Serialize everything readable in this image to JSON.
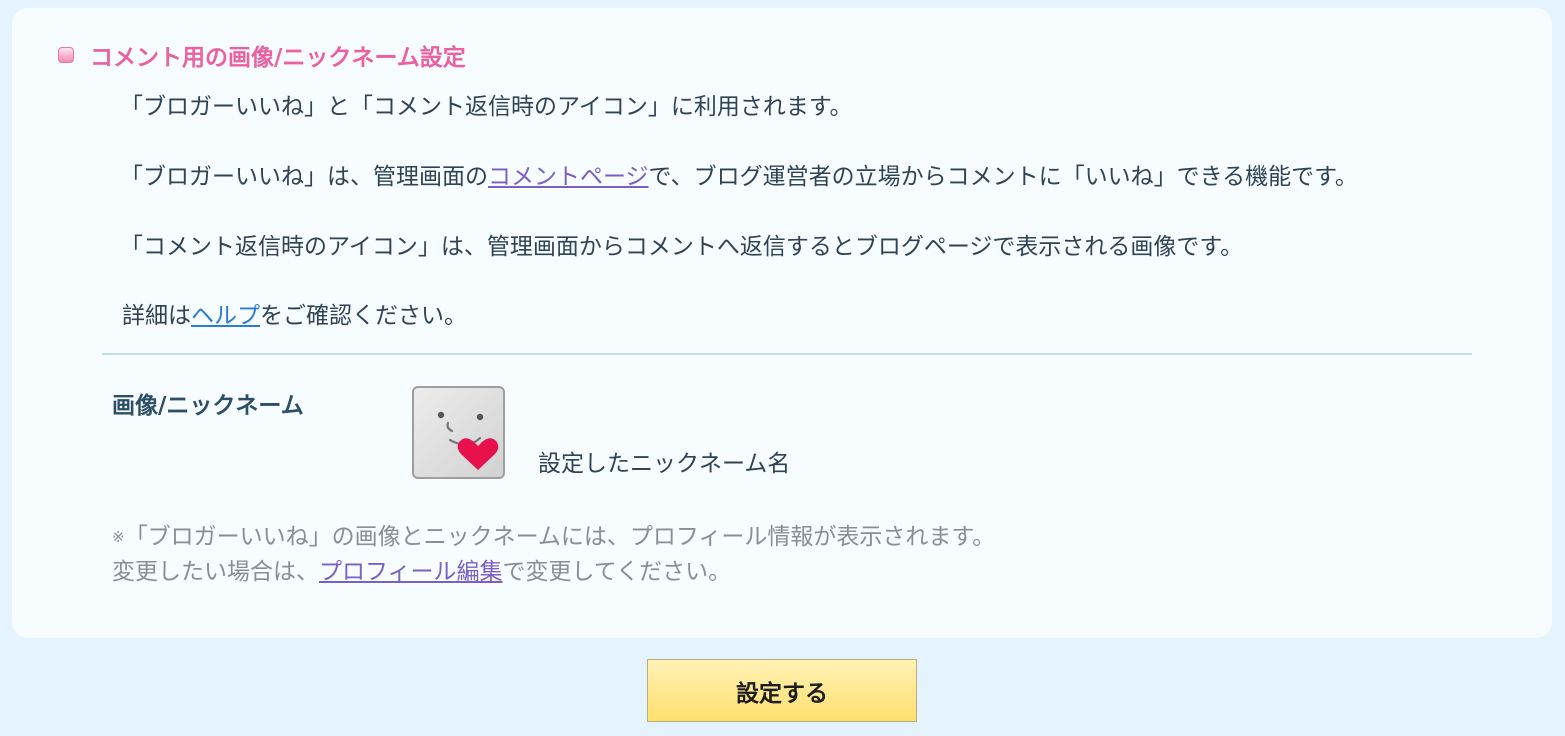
{
  "section": {
    "title": "コメント用の画像/ニックネーム設定"
  },
  "intro": {
    "line1": "「ブロガーいいね」と「コメント返信時のアイコン」に利用されます。",
    "para2_before": "「ブロガーいいね」は、管理画面の",
    "para2_link": "コメントページ",
    "para2_after": "で、ブログ運営者の立場からコメントに「いいね」できる機能です。",
    "para3": "「コメント返信時のアイコン」は、管理画面からコメントへ返信するとブログページで表示される画像です。",
    "help_before": "詳細は",
    "help_link": "ヘルプ",
    "help_after": "をご確認ください。"
  },
  "field": {
    "label": "画像/ニックネーム",
    "nickname": "設定したニックネーム名"
  },
  "note": {
    "mark": "※",
    "line1": "「ブロガーいいね」の画像とニックネームには、プロフィール情報が表示されます。",
    "line2_before": "変更したい場合は、",
    "line2_link": "プロフィール編集",
    "line2_after": "で変更してください。"
  },
  "submit": {
    "label": "設定する"
  },
  "colors": {
    "background": "#e4f3fd",
    "card": "#f6fcff",
    "title": "#ec5fa0",
    "link": "#7b5fc9",
    "help_link": "#2c7bd6",
    "button": "#ffdf6e"
  },
  "icons": {
    "section_marker": "pink-square-icon",
    "avatar": "face-with-heart-icon"
  }
}
